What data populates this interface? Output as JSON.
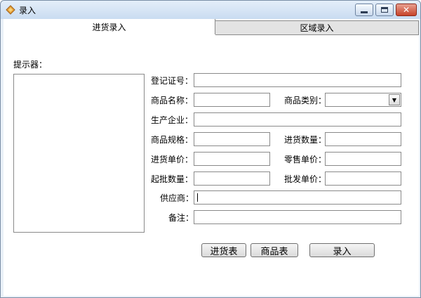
{
  "window": {
    "title": "录入",
    "icon": "app-icon",
    "controls": {
      "minimize": "minimize-icon",
      "maximize": "maximize-icon",
      "close": "close-icon"
    }
  },
  "tabs": [
    {
      "label": "进货录入",
      "active": true
    },
    {
      "label": "区域录入",
      "active": false
    }
  ],
  "hint": {
    "label": "提示器："
  },
  "form": {
    "registration_no": {
      "label": "登记证号：",
      "value": ""
    },
    "product_name": {
      "label": "商品名称：",
      "value": ""
    },
    "product_category": {
      "label": "商品类别：",
      "value": ""
    },
    "manufacturer": {
      "label": "生产企业：",
      "value": ""
    },
    "product_spec": {
      "label": "商品规格：",
      "value": ""
    },
    "purchase_qty": {
      "label": "进货数量：",
      "value": ""
    },
    "purchase_price": {
      "label": "进货单价：",
      "value": ""
    },
    "retail_price": {
      "label": "零售单价：",
      "value": ""
    },
    "min_wholesale_qty": {
      "label": "起批数量：",
      "value": ""
    },
    "wholesale_price": {
      "label": "批发单价：",
      "value": ""
    },
    "supplier": {
      "label": "供应商：",
      "value": ""
    },
    "remarks": {
      "label": "备注：",
      "value": ""
    }
  },
  "buttons": {
    "purchase_table": "进货表",
    "product_table": "商品表",
    "submit": "录入"
  }
}
